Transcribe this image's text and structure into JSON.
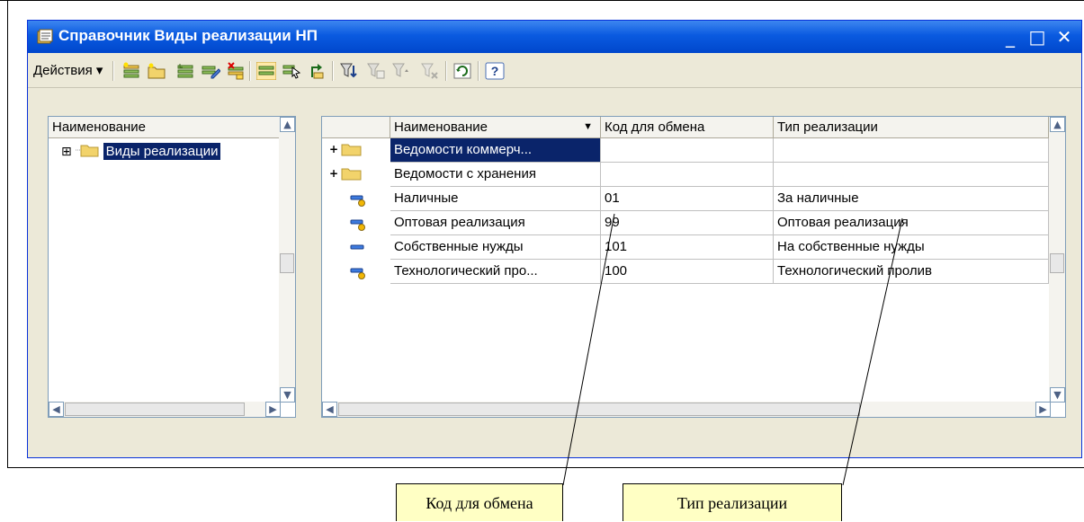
{
  "window": {
    "title": "Справочник Виды реализации НП",
    "controls": [
      "minimize-icon",
      "maximize-icon",
      "close-icon"
    ]
  },
  "toolbar": {
    "actions_label": "Действия ▾",
    "icons": [
      "add-icon",
      "add-folder-icon",
      "copy-icon",
      "edit-icon",
      "delete-mark-icon",
      "hierarchy-icon",
      "select-icon",
      "up-level-icon",
      "filter-icon",
      "filter-by-value-icon",
      "filter-history-icon",
      "clear-filter-icon",
      "refresh-icon",
      "help-icon"
    ]
  },
  "tree": {
    "header": "Наименование",
    "root": {
      "expander": "⊞",
      "label": "Виды реализации"
    }
  },
  "list": {
    "columns": [
      "Наименование",
      "Код для обмена",
      "Тип реализации"
    ],
    "sort_indicator": "▼",
    "rows": [
      {
        "icon": "folder-icon",
        "name": "Ведомости коммерч...",
        "code": "",
        "type": "",
        "selected": true
      },
      {
        "icon": "folder-icon",
        "name": "Ведомости с хранения",
        "code": "",
        "type": "",
        "selected": false
      },
      {
        "icon": "item-icon",
        "name": "Наличные",
        "code": "01",
        "type": "За наличные",
        "selected": false
      },
      {
        "icon": "item-icon",
        "name": "Оптовая реализация",
        "code": "99",
        "type": "Оптовая реализация",
        "selected": false
      },
      {
        "icon": "item-dash-icon",
        "name": "Собственные нужды",
        "code": "101",
        "type": "На собственные нужды",
        "selected": false
      },
      {
        "icon": "item-icon",
        "name": "Технологический про...",
        "code": "100",
        "type": "Технологический пролив",
        "selected": false
      }
    ]
  },
  "callouts": {
    "code": "Код для обмена",
    "type": "Тип реализации"
  },
  "colors": {
    "title_bar": "#0a5ae0",
    "selection": "#0a246a",
    "window_bg": "#ece9d8",
    "callout_bg": "#ffffc4"
  }
}
